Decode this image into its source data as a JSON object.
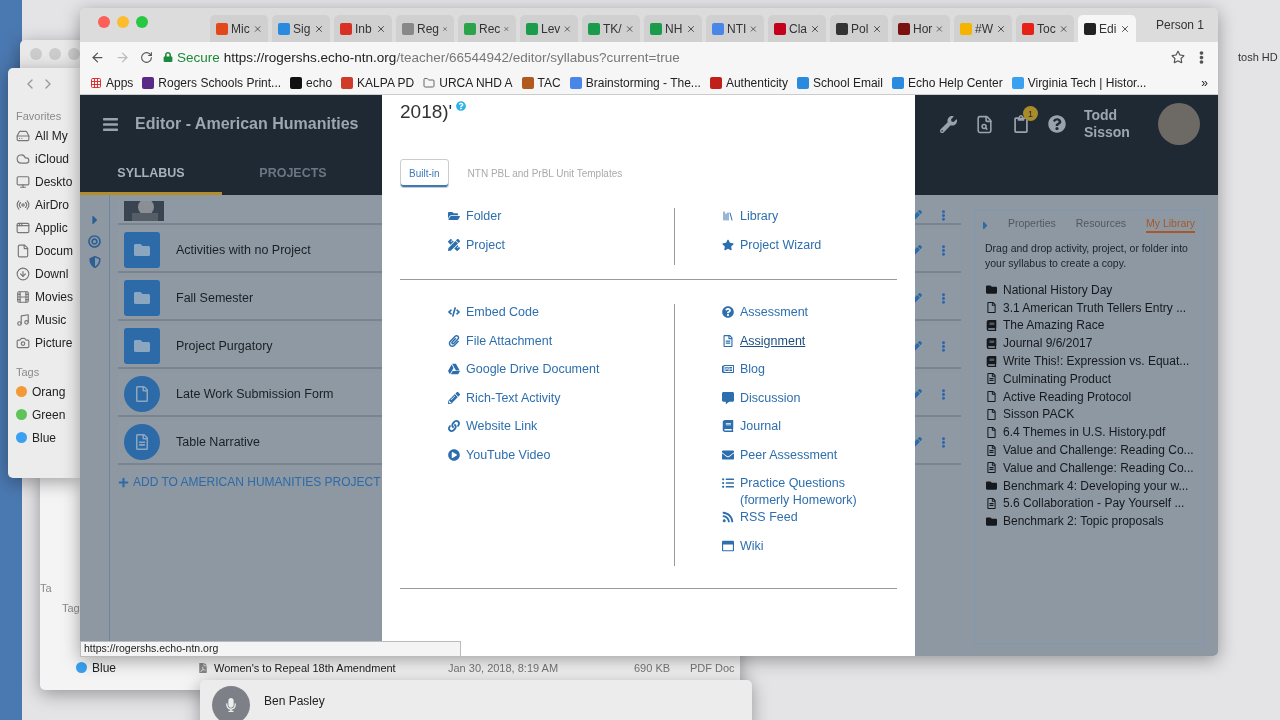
{
  "finder_sidebar": {
    "favorites_heading": "Favorites",
    "items": [
      "All My",
      "iCloud",
      "Deskto",
      "AirDro",
      "Applic",
      "Docum",
      "Downl",
      "Movies",
      "Music",
      "Picture"
    ],
    "tags_heading": "Tags",
    "tags": [
      {
        "label": "Orang",
        "color": "#f29a38"
      },
      {
        "label": "Green",
        "color": "#5cc45a"
      },
      {
        "label": "Blue",
        "color": "#3aa0f0"
      }
    ]
  },
  "desktop": {
    "drive_label": "tosh HD",
    "back_finder": {
      "tags_label": "Ta",
      "tags_heading": "Tag",
      "tag": {
        "label": "Blue",
        "color": "#3aa0f0"
      },
      "file_row": {
        "name": "Women's to Repeal 18th Amendment",
        "date": "Jan 30, 2018, 8:19 AM",
        "size": "690 KB",
        "kind": "PDF Doc"
      },
      "contact": "Ben Pasley"
    }
  },
  "browser": {
    "tabs": [
      {
        "label": "Mic",
        "selected": false
      },
      {
        "label": "Sig",
        "selected": false
      },
      {
        "label": "Inb",
        "selected": false
      },
      {
        "label": "Reg",
        "selected": false
      },
      {
        "label": "Rec",
        "selected": false
      },
      {
        "label": "Lev",
        "selected": false
      },
      {
        "label": "TK/",
        "selected": false
      },
      {
        "label": "NH",
        "selected": false
      },
      {
        "label": "NTI",
        "selected": false
      },
      {
        "label": "Cla",
        "selected": false
      },
      {
        "label": "Pol",
        "selected": false
      },
      {
        "label": "Hor",
        "selected": false
      },
      {
        "label": "#W",
        "selected": false
      },
      {
        "label": "Toc",
        "selected": false
      },
      {
        "label": "Edi",
        "selected": true
      }
    ],
    "profile": "Person 1",
    "secure_label": "Secure",
    "url_host": "https://rogershs.echo-ntn.org",
    "url_path": "/teacher/66544942/editor/syllabus?current=true",
    "bookmarks": [
      "Apps",
      "Rogers Schools Print...",
      "echo",
      "KALPA PD",
      "URCA NHD A",
      "TAC",
      "Brainstorming - The...",
      "Authenticity",
      "School Email",
      "Echo Help Center",
      "Virginia Tech | Histor..."
    ],
    "bookmarks_more": "»",
    "status_url": "https://rogershs.echo-ntn.org"
  },
  "app": {
    "title": "Editor - American Humanities",
    "tabs": [
      {
        "label": "SYLLABUS",
        "selected": true
      },
      {
        "label": "PROJECTS",
        "selected": false
      }
    ],
    "notification_count": "1",
    "user_name": "Todd Sisson",
    "syllabus": [
      {
        "kind": "picture"
      },
      {
        "label": "Activities with no Project",
        "kind": "folder"
      },
      {
        "label": "Fall Semester",
        "kind": "folder"
      },
      {
        "label": "Project Purgatory",
        "kind": "folder"
      },
      {
        "label": "Late Work Submission Form",
        "kind": "file"
      },
      {
        "label": "Table Narrative",
        "kind": "document"
      }
    ],
    "add_link": "ADD TO AMERICAN HUMANITIES PROJECT",
    "side_panel": {
      "tabs": [
        {
          "label": "Properties",
          "selected": false
        },
        {
          "label": "Resources",
          "selected": false
        },
        {
          "label": "My Library",
          "selected": true
        }
      ],
      "hint": "Drag and drop activity, project, or folder into your syllabus to create a copy.",
      "library": [
        {
          "label": "National History Day",
          "kind": "folder"
        },
        {
          "label": "3.1 American Truth Tellers Entry ...",
          "kind": "file"
        },
        {
          "label": "The Amazing Race",
          "kind": "book"
        },
        {
          "label": "Journal 9/6/2017",
          "kind": "book"
        },
        {
          "label": "Write This!: Expression vs. Equat...",
          "kind": "book"
        },
        {
          "label": "Culminating Product",
          "kind": "document"
        },
        {
          "label": "Active Reading Protocol",
          "kind": "file"
        },
        {
          "label": "Sisson PACK",
          "kind": "file"
        },
        {
          "label": "6.4 Themes in U.S. History.pdf",
          "kind": "file"
        },
        {
          "label": "Value and Challenge: Reading Co...",
          "kind": "document"
        },
        {
          "label": "Value and Challenge: Reading Co...",
          "kind": "document"
        },
        {
          "label": "Benchmark 4: Developing your w...",
          "kind": "folder"
        },
        {
          "label": "5.6 Collaboration - Pay Yourself ...",
          "kind": "document"
        },
        {
          "label": "Benchmark 2: Topic proposals",
          "kind": "folder"
        }
      ]
    }
  },
  "modal": {
    "title": "2018)'",
    "tabs": [
      {
        "label": "Built-in",
        "selected": true
      },
      {
        "label": "NTN PBL and PrBL Unit Templates",
        "selected": false
      }
    ],
    "structure": {
      "left": [
        {
          "label": "Folder",
          "hovered": false
        },
        {
          "label": "Project",
          "hovered": false
        }
      ],
      "right": [
        {
          "label": "Library",
          "hovered": false
        },
        {
          "label": "Project Wizard",
          "hovered": false
        }
      ]
    },
    "activities": {
      "left": [
        {
          "label": "Embed Code",
          "hovered": false
        },
        {
          "label": "File Attachment",
          "hovered": false
        },
        {
          "label": "Google Drive Document",
          "hovered": false
        },
        {
          "label": "Rich-Text Activity",
          "hovered": false
        },
        {
          "label": "Website Link",
          "hovered": false
        },
        {
          "label": "YouTube Video",
          "hovered": false
        }
      ],
      "right": [
        {
          "label": "Assessment",
          "hovered": false
        },
        {
          "label": "Assignment",
          "hovered": true
        },
        {
          "label": "Blog",
          "hovered": false
        },
        {
          "label": "Discussion",
          "hovered": false
        },
        {
          "label": "Journal",
          "hovered": false
        },
        {
          "label": "Peer Assessment",
          "hovered": false
        },
        {
          "label": "Practice Questions (formerly Homework)",
          "hovered": false
        },
        {
          "label": "RSS Feed",
          "hovered": false
        },
        {
          "label": "Wiki",
          "hovered": false
        }
      ]
    }
  }
}
